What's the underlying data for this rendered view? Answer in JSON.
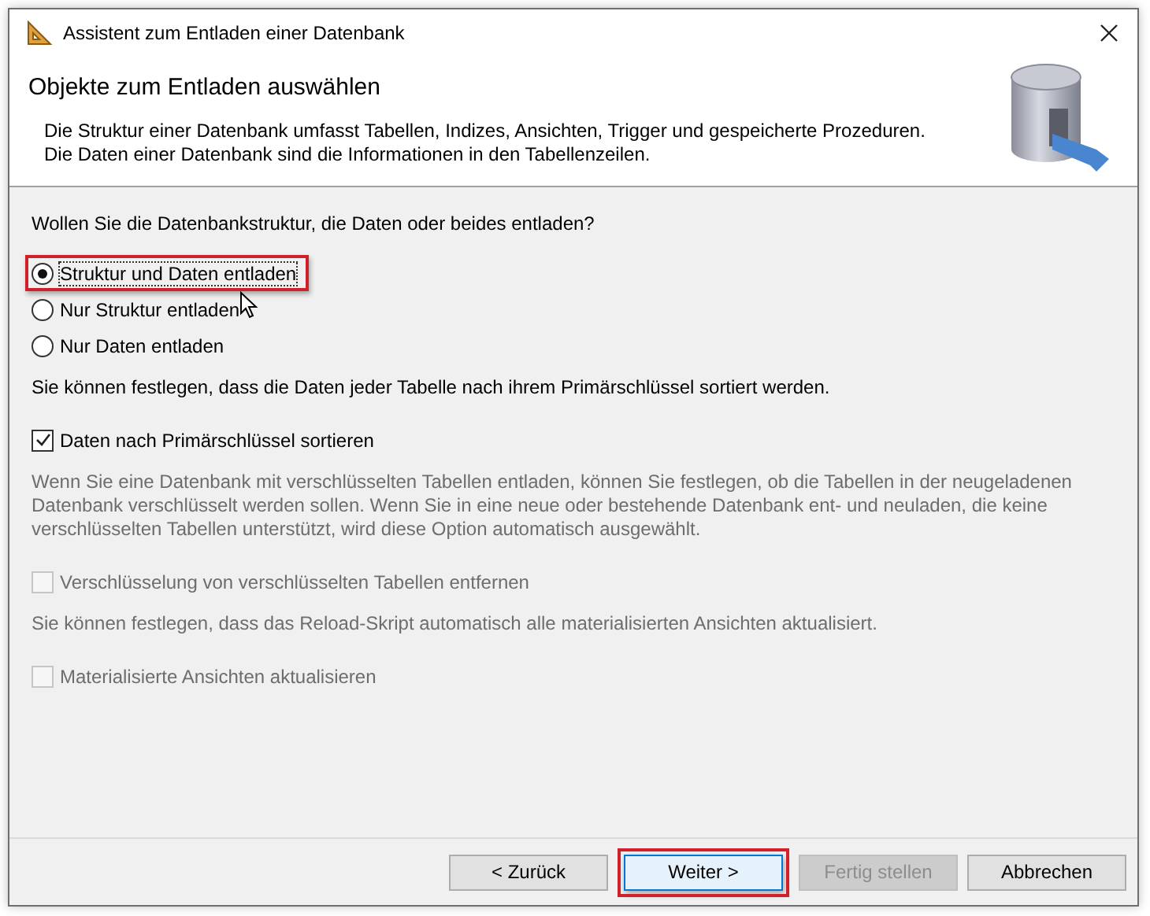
{
  "window": {
    "title": "Assistent zum Entladen einer Datenbank"
  },
  "header": {
    "title": "Objekte zum Entladen auswählen",
    "description": [
      "Die Struktur einer Datenbank umfasst Tabellen, Indizes, Ansichten, Trigger und gespeicherte Prozeduren.",
      "Die Daten einer Datenbank sind die Informationen in den Tabellenzeilen."
    ]
  },
  "body": [
    {
      "kind": "text",
      "text": "Wollen Sie die Datenbankstruktur, die Daten oder beides entladen?",
      "disabled": false
    },
    {
      "kind": "radio",
      "label": "Struktur und Daten entladen",
      "selected": true,
      "highlighted": true
    },
    {
      "kind": "radio",
      "label": "Nur Struktur entladen",
      "selected": false,
      "highlighted": false
    },
    {
      "kind": "radio",
      "label": "Nur Daten entladen",
      "selected": false,
      "highlighted": false
    },
    {
      "kind": "text",
      "text": "Sie können festlegen, dass die Daten jeder Tabelle nach ihrem Primärschlüssel sortiert werden.",
      "disabled": false
    },
    {
      "kind": "checkbox",
      "label": "Daten nach Primärschlüssel sortieren",
      "checked": true,
      "disabled": false
    },
    {
      "kind": "text",
      "text": "Wenn Sie eine Datenbank mit verschlüsselten Tabellen entladen, können Sie festlegen, ob die Tabellen in der neugeladenen Datenbank verschlüsselt werden sollen. Wenn Sie in eine neue oder bestehende Datenbank ent- und neuladen, die keine verschlüsselten Tabellen unterstützt, wird diese Option automatisch ausgewählt.",
      "disabled": true
    },
    {
      "kind": "checkbox",
      "label": "Verschlüsselung von verschlüsselten Tabellen entfernen",
      "checked": false,
      "disabled": true
    },
    {
      "kind": "text",
      "text": "Sie können festlegen, dass das Reload-Skript automatisch alle materialisierten Ansichten aktualisiert.",
      "disabled": true
    },
    {
      "kind": "checkbox",
      "label": "Materialisierte Ansichten aktualisieren",
      "checked": false,
      "disabled": true
    }
  ],
  "buttons": [
    {
      "label": "< Zurück",
      "disabled": false,
      "default": false,
      "highlighted": false
    },
    {
      "label": "Weiter >",
      "disabled": false,
      "default": true,
      "highlighted": true
    },
    {
      "label": "Fertig stellen",
      "disabled": true,
      "default": false,
      "highlighted": false
    },
    {
      "label": "Abbrechen",
      "disabled": false,
      "default": false,
      "highlighted": false
    }
  ]
}
